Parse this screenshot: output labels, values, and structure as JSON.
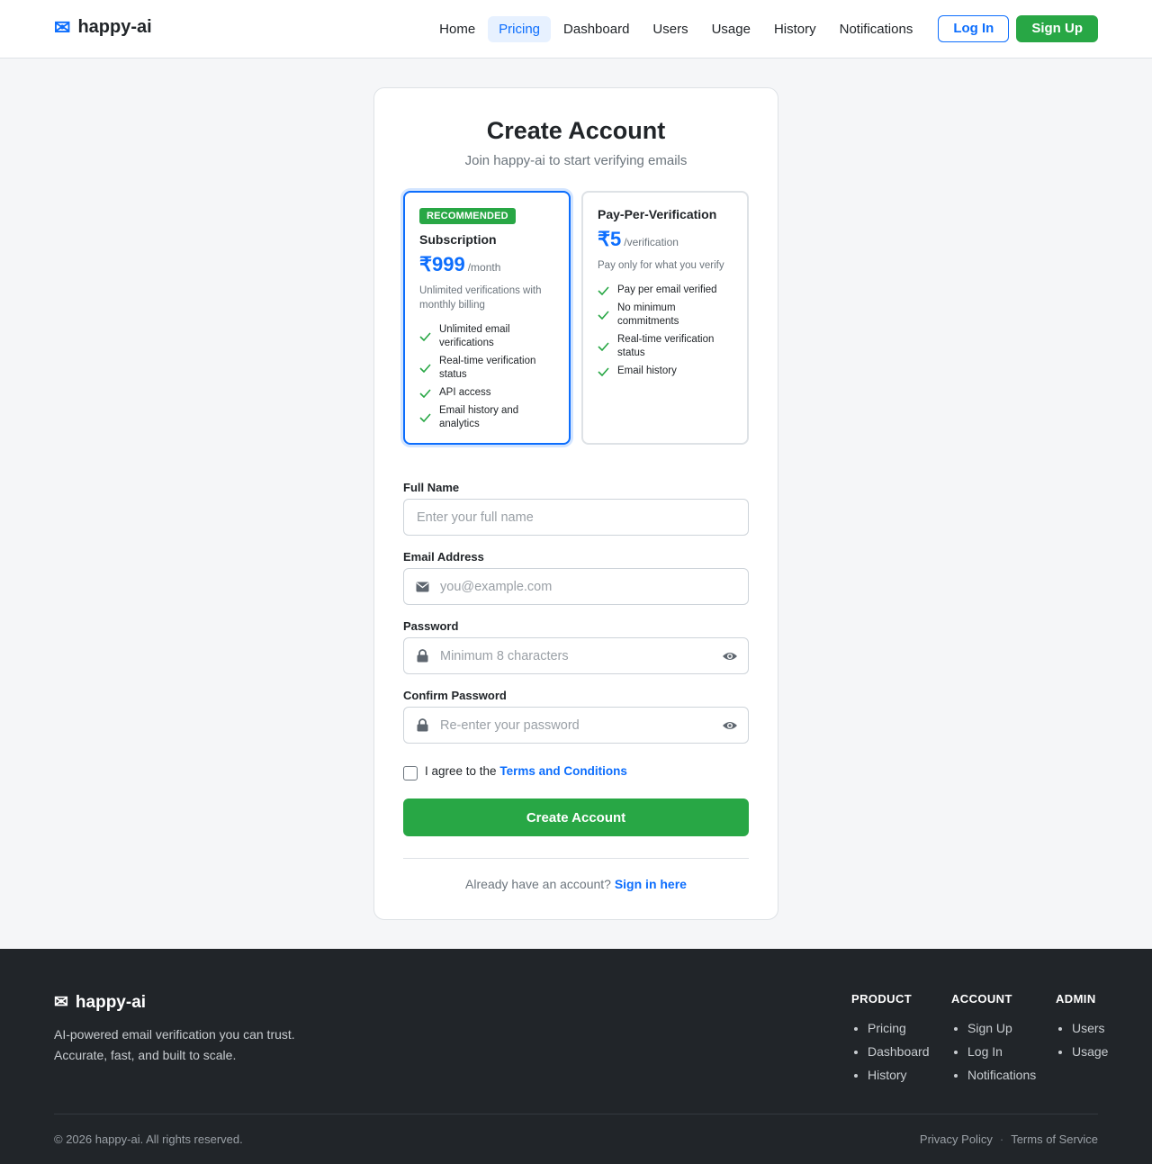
{
  "header": {
    "brand_icon": "envelope-icon",
    "brand": "happy-ai",
    "nav": [
      {
        "label": "Home"
      },
      {
        "label": "Pricing"
      },
      {
        "label": "Dashboard"
      },
      {
        "label": "Users"
      },
      {
        "label": "Usage"
      },
      {
        "label": "History"
      },
      {
        "label": "Notifications"
      }
    ],
    "login": "Log In",
    "signup": "Sign Up"
  },
  "card": {
    "title": "Create Account",
    "subtitle": "Join happy-ai to start verifying emails",
    "plans": [
      {
        "badge": "RECOMMENDED",
        "name": "Subscription",
        "price": "₹999",
        "per": "/month",
        "desc": "Unlimited verifications with monthly billing",
        "features": [
          "Unlimited email verifications",
          "Real-time verification status",
          "API access",
          "Email history and analytics"
        ]
      },
      {
        "name": "Pay-Per-Verification",
        "price": "₹5",
        "per": "/verification",
        "desc": "Pay only for what you verify",
        "features": [
          "Pay per email verified",
          "No minimum commitments",
          "Real-time verification status",
          "Email history"
        ]
      }
    ],
    "fields": {
      "full_name": {
        "label": "Full Name",
        "placeholder": "Enter your full name"
      },
      "email": {
        "label": "Email Address",
        "placeholder": "you@example.com"
      },
      "password": {
        "label": "Password",
        "placeholder": "Minimum 8 characters"
      },
      "confirm": {
        "label": "Confirm Password",
        "placeholder": "Re-enter your password"
      }
    },
    "terms_prefix": "I agree to the",
    "terms_link": "Terms and Conditions",
    "submit": "Create Account",
    "signin_prefix": "Already have an account?",
    "signin_link": "Sign in here"
  },
  "footer": {
    "brand": "happy-ai",
    "tagline_1": "AI-powered email verification you can trust.",
    "tagline_2": "Accurate, fast, and built to scale.",
    "columns": [
      {
        "title": "PRODUCT",
        "links": [
          "Pricing",
          "Dashboard",
          "History"
        ]
      },
      {
        "title": "ACCOUNT",
        "links": [
          "Sign Up",
          "Log In",
          "Notifications"
        ]
      },
      {
        "title": "ADMIN",
        "links": [
          "Users",
          "Usage"
        ]
      }
    ],
    "copyright": "© 2026 happy-ai. All rights reserved.",
    "privacy": "Privacy Policy",
    "separator": "·",
    "terms": "Terms of Service"
  },
  "colors": {
    "primary": "#0d6efd",
    "success": "#28a745",
    "footer_bg": "#212529",
    "page_bg": "#f5f6f8"
  }
}
